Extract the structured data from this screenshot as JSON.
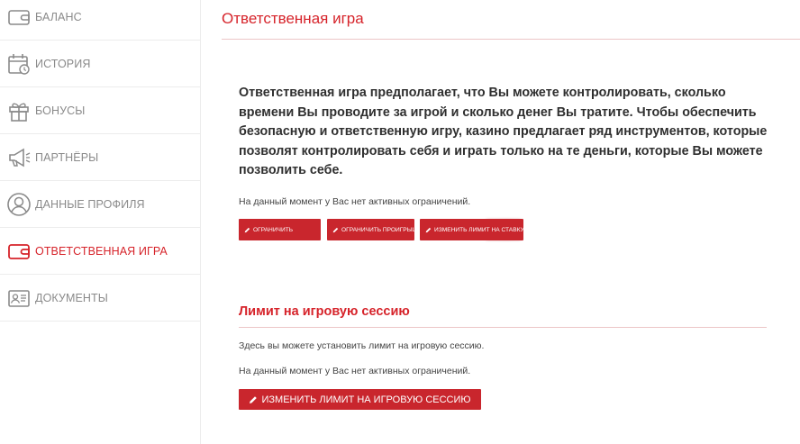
{
  "sidebar": {
    "items": [
      {
        "label": "БАЛАНС",
        "icon": "wallet-icon"
      },
      {
        "label": "ИСТОРИЯ",
        "icon": "calendar-icon"
      },
      {
        "label": "БОНУСЫ",
        "icon": "gift-icon"
      },
      {
        "label": "ПАРТНЁРЫ",
        "icon": "megaphone-icon"
      },
      {
        "label": "ДАННЫЕ ПРОФИЛЯ",
        "icon": "user-icon"
      },
      {
        "label": "ОТВЕТСТВЕННАЯ ИГРА",
        "icon": "wallet-icon",
        "active": true
      },
      {
        "label": "ДОКУМЕНТЫ",
        "icon": "id-card-icon"
      }
    ]
  },
  "main": {
    "title": "Ответственная игра",
    "intro": "Ответственная игра предполагает, что Вы можете контролировать, сколько времени Вы проводите за игрой и сколько денег Вы тратите. Чтобы обеспечить безопасную и ответственную игру, казино предлагает ряд инструментов, которые позволят контролировать себя и играть только на те деньги, которые Вы можете позволить себе.",
    "status": "На данный момент у Вас нет активных ограничений.",
    "buttons": {
      "limit_deposit": "ОГРАНИЧИТЬ",
      "limit_loss": "ОГРАНИЧИТЬ ПРОИГРЫШ",
      "change_bet_limit": "ИЗМЕНИТЬ ЛИМИТ НА СТАВКУ"
    },
    "session": {
      "title": "Лимит на игровую сессию",
      "description": "Здесь вы можете установить лимит на игровую сессию.",
      "status": "На данный момент у Вас нет активных ограничений.",
      "button": "ИЗМЕНИТЬ ЛИМИТ НА ИГРОВУЮ СЕССИЮ"
    }
  },
  "colors": {
    "accent": "#d6232a",
    "button": "#c9262d",
    "muted": "#8a8a8a"
  }
}
